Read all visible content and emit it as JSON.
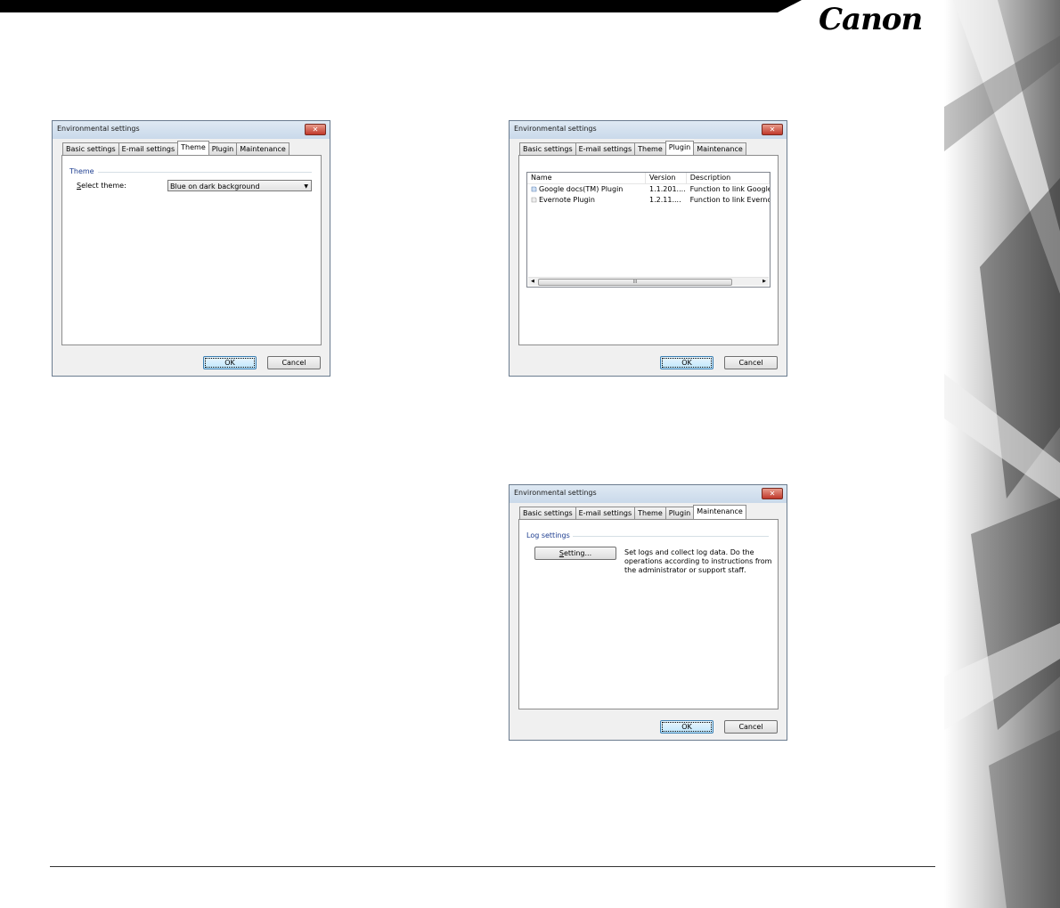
{
  "brand": {
    "logo_text": "Canon"
  },
  "dialogs": {
    "theme": {
      "title": "Environmental settings",
      "tabs": [
        "Basic settings",
        "E-mail settings",
        "Theme",
        "Plugin",
        "Maintenance"
      ],
      "active_tab": "Theme",
      "group_label": "Theme",
      "select_theme_label_prefix": "S",
      "select_theme_label_rest": "elect theme:",
      "select_theme_value": "Blue on dark background",
      "ok_label": "OK",
      "cancel_label": "Cancel"
    },
    "plugin": {
      "title": "Environmental settings",
      "tabs": [
        "Basic settings",
        "E-mail settings",
        "Theme",
        "Plugin",
        "Maintenance"
      ],
      "active_tab": "Plugin",
      "columns": [
        "Name",
        "Version",
        "Description"
      ],
      "rows": [
        {
          "name": "Google docs(TM) Plugin",
          "version": "1.1.201....",
          "description": "Function to link Google"
        },
        {
          "name": "Evernote Plugin",
          "version": "1.2.11....",
          "description": "Function to link Evernot"
        }
      ],
      "scroll_grip": "III",
      "ok_label": "OK",
      "cancel_label": "Cancel"
    },
    "maintenance": {
      "title": "Environmental settings",
      "tabs": [
        "Basic settings",
        "E-mail settings",
        "Theme",
        "Plugin",
        "Maintenance"
      ],
      "active_tab": "Maintenance",
      "group_label": "Log settings",
      "setting_button_prefix": "S",
      "setting_button_rest": "etting...",
      "description": "Set logs and collect log data. Do the operations according to instructions from the administrator or support staff.",
      "ok_label": "OK",
      "cancel_label": "Cancel"
    }
  },
  "colors": {
    "accent_group": "#1e3e90",
    "close_button": "#c0392b"
  },
  "icons": {
    "close": "close-icon",
    "dropdown": "chevron-down-icon",
    "plugin": "plugin-icon"
  }
}
